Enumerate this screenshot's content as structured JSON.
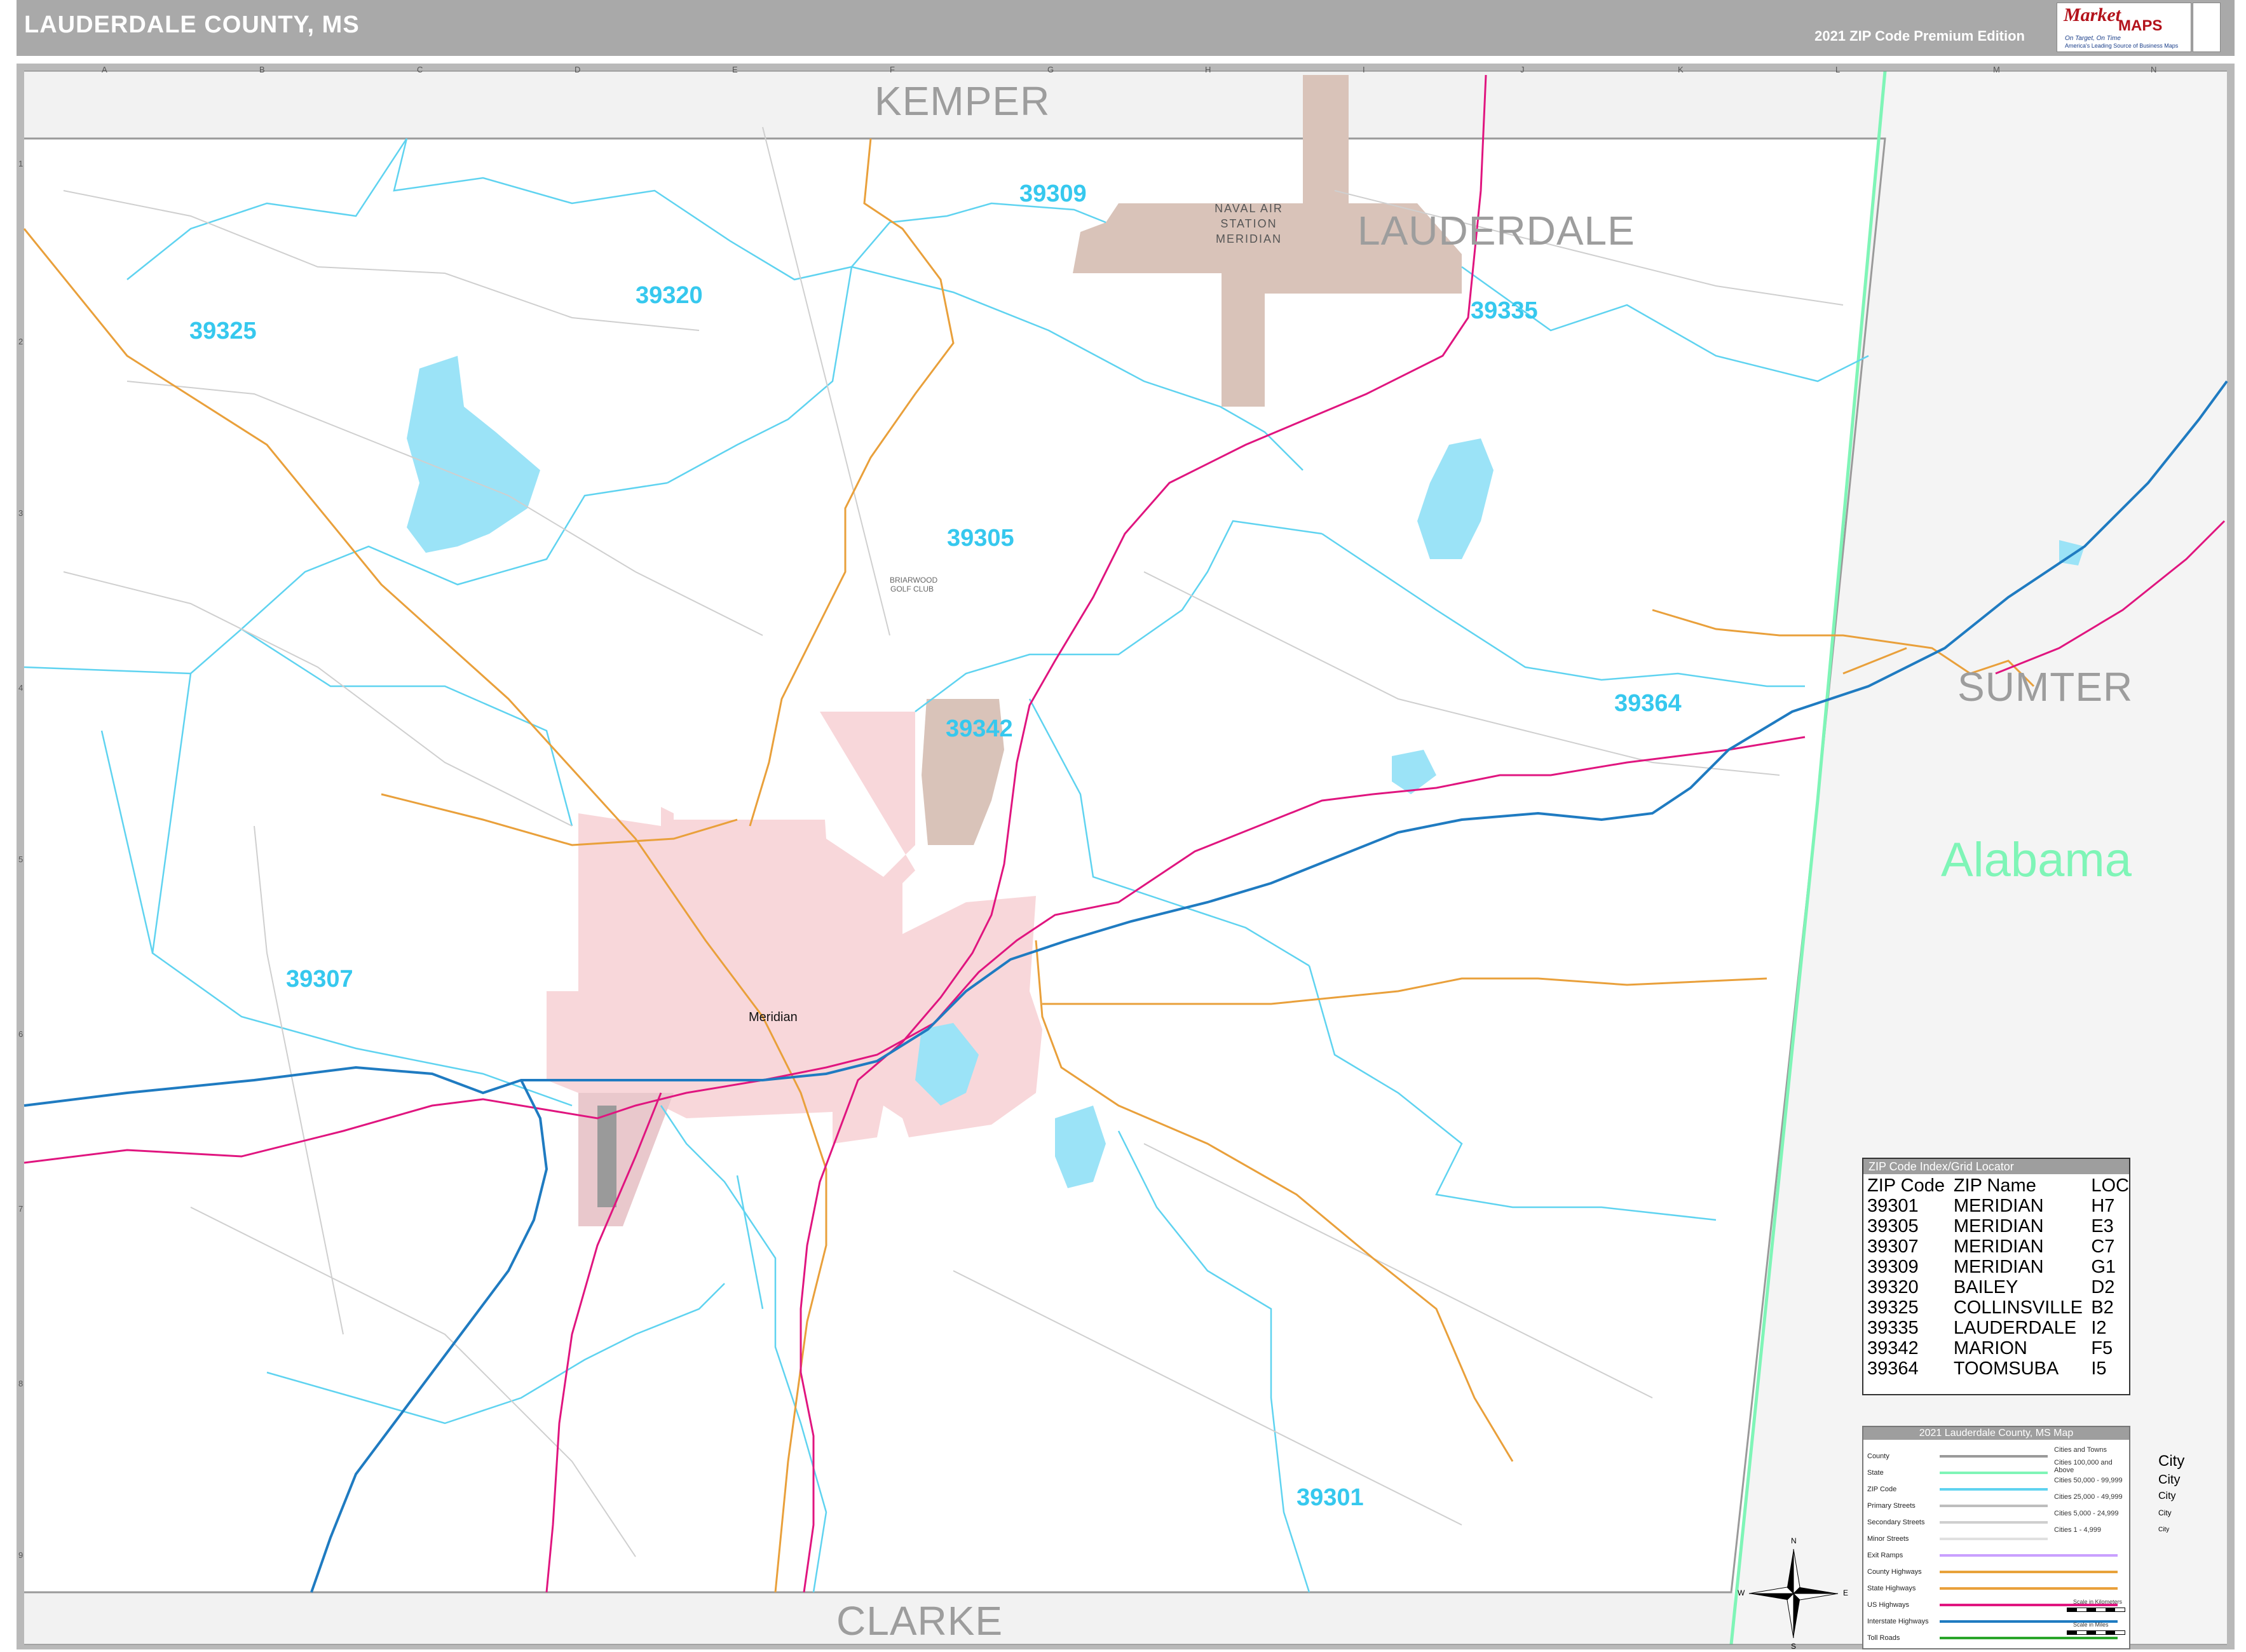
{
  "header": {
    "title": "LAUDERDALE COUNTY, MS",
    "edition": "2021 ZIP Code Premium Edition",
    "logo_brand": "Market",
    "logo_brand2": "MAPS",
    "logo_tagline": "On Target, On Time",
    "logo_subtitle": "America's Leading Source of Business Maps"
  },
  "grid": {
    "letters": [
      "A",
      "B",
      "C",
      "D",
      "E",
      "F",
      "G",
      "H",
      "I",
      "J",
      "K",
      "L",
      "M",
      "N"
    ],
    "numbers": [
      "1",
      "2",
      "3",
      "4",
      "5",
      "6",
      "7",
      "8",
      "9"
    ]
  },
  "counties": {
    "kemper": "KEMPER",
    "lauderdale": "LAUDERDALE",
    "sumter": "SUMTER",
    "clarke": "CLARKE"
  },
  "state": "Alabama",
  "zip_labels": [
    {
      "code": "39309"
    },
    {
      "code": "39320"
    },
    {
      "code": "39325"
    },
    {
      "code": "39335"
    },
    {
      "code": "39305"
    },
    {
      "code": "39342"
    },
    {
      "code": "39364"
    },
    {
      "code": "39307"
    },
    {
      "code": "39301"
    }
  ],
  "places": {
    "naval_air_station": "NAVAL AIR STATION MERIDIAN",
    "meridian": "Meridian",
    "golf_club": "BRIARWOOD GOLF CLUB"
  },
  "zip_index": {
    "title": "ZIP Code Index/Grid Locator",
    "columns": [
      "ZIP Code",
      "ZIP Name",
      "LOC"
    ],
    "rows": [
      [
        "39301",
        "MERIDIAN",
        "H7"
      ],
      [
        "39305",
        "MERIDIAN",
        "E3"
      ],
      [
        "39307",
        "MERIDIAN",
        "C7"
      ],
      [
        "39309",
        "MERIDIAN",
        "G1"
      ],
      [
        "39320",
        "BAILEY",
        "D2"
      ],
      [
        "39325",
        "COLLINSVILLE",
        "B2"
      ],
      [
        "39335",
        "LAUDERDALE",
        "I2"
      ],
      [
        "39342",
        "MARION",
        "F5"
      ],
      [
        "39364",
        "TOOMSUBA",
        "I5"
      ]
    ]
  },
  "legend": {
    "title": "2021 Lauderdale County, MS Map",
    "items": [
      "County",
      "State",
      "ZIP Code",
      "Primary Streets",
      "Secondary Streets",
      "Minor Streets",
      "Exit Ramps",
      "County Highways",
      "State Highways",
      "US Highways",
      "Interstate Highways",
      "Toll Roads"
    ],
    "colors": {
      "County": "#9a9a9a",
      "State": "#7ff5b7",
      "ZIP Code": "#5fd3f0",
      "Primary Streets": "#bdbdbd",
      "Secondary Streets": "#cfcfcf",
      "Minor Streets": "#e0e0e0",
      "Exit Ramps": "#c9a0ff",
      "County Highways": "#e8a23a",
      "State Highways": "#e9a03b",
      "US Highways": "#e0157f",
      "Interstate Highways": "#1f7bc1",
      "Toll Roads": "#2aa52a"
    },
    "cities_heading": "Cities and Towns",
    "cities": [
      {
        "range": "Cities 100,000 and Above",
        "word": "City"
      },
      {
        "range": "Cities 50,000 - 99,999",
        "word": "City"
      },
      {
        "range": "Cities 25,000 - 49,999",
        "word": "City"
      },
      {
        "range": "Cities 5,000 - 24,999",
        "word": "City"
      },
      {
        "range": "Cities 1 - 4,999",
        "word": "City"
      }
    ],
    "scale_km": "Scale in Kilometers",
    "scale_mi": "Scale in Miles"
  },
  "compass": {
    "n": "N",
    "s": "S",
    "e": "E",
    "w": "W"
  },
  "colors": {
    "water": "#9be3f7",
    "city_fill": "#f8d7da",
    "base_fill": "#d9c3b9",
    "zip_line": "#5fd3f0",
    "interstate": "#1f7bc1",
    "us_highway": "#e0157f",
    "state_highway": "#e9a03b",
    "state_line": "#7ff5b7"
  }
}
